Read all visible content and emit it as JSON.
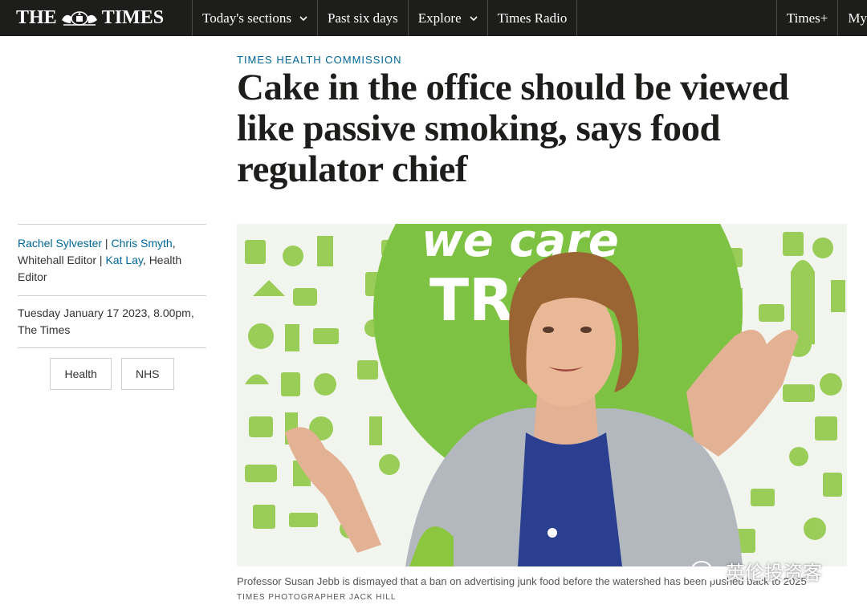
{
  "nav": {
    "logo_left": "THE",
    "logo_right": "TIMES",
    "items": [
      {
        "label": "Today's sections",
        "dropdown": true
      },
      {
        "label": "Past six days",
        "dropdown": false
      },
      {
        "label": "Explore",
        "dropdown": true
      },
      {
        "label": "Times Radio",
        "dropdown": false
      }
    ],
    "right_items": [
      "Times+",
      "My"
    ]
  },
  "article": {
    "kicker": "TIMES HEALTH COMMISSION",
    "headline": "Cake in the office should be viewed like passive smoking, says food regulator chief",
    "authors": [
      {
        "name": "Rachel Sylvester",
        "role": ""
      },
      {
        "name": "Chris Smyth",
        "role": "Whitehall Editor"
      },
      {
        "name": "Kat Lay",
        "role": "Health Editor"
      }
    ],
    "date": "Tuesday January 17 2023, 8.00pm, The Times",
    "tags": [
      "Health",
      "NHS"
    ],
    "caption": "Professor Susan Jebb is dismayed that a ban on advertising junk food before the watershed has been pushed back to 2025",
    "credit": "TIMES PHOTOGRAPHER JACK HILL",
    "photo_wall_text": "we care TRU"
  },
  "watermark": "英伦投资客",
  "colors": {
    "nav_bg": "#1d1d1b",
    "link": "#006699",
    "wall_green": "#7dc242"
  }
}
